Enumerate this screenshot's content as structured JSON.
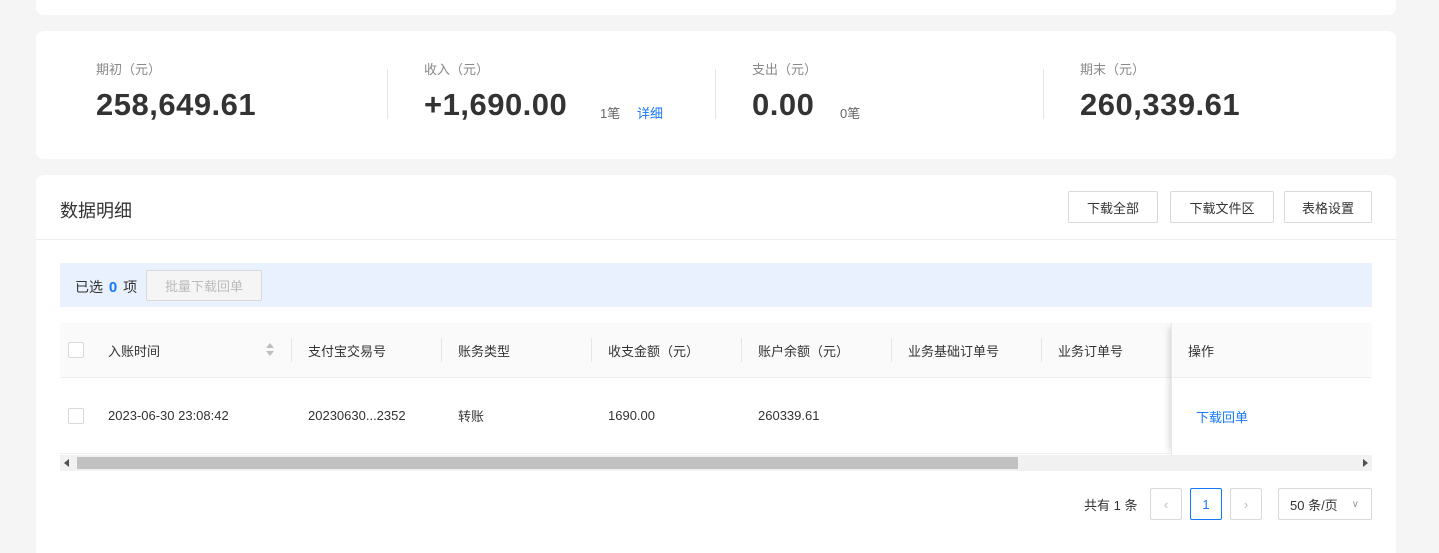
{
  "summary": {
    "opening": {
      "label": "期初（元）",
      "value": "258,649.61"
    },
    "income": {
      "label": "收入（元）",
      "value": "+1,690.00",
      "count": "1笔",
      "link": "详细"
    },
    "expense": {
      "label": "支出（元）",
      "value": "0.00",
      "count": "0笔"
    },
    "closing": {
      "label": "期末（元）",
      "value": "260,339.61"
    }
  },
  "detail": {
    "title": "数据明细",
    "buttons": {
      "download_all": "下载全部",
      "download_area": "下载文件区",
      "table_settings": "表格设置"
    },
    "selection": {
      "prefix": "已选",
      "count": "0",
      "suffix": "项",
      "batch_button": "批量下载回单"
    },
    "columns": [
      "入账时间",
      "支付宝交易号",
      "账务类型",
      "收支金额（元）",
      "账户余额（元）",
      "业务基础订单号",
      "业务订单号",
      "操作"
    ],
    "rows": [
      {
        "time": "2023-06-30 23:08:42",
        "trade_no": "20230630...2352",
        "type": "转账",
        "amount": "1690.00",
        "balance": "260339.61",
        "base_order": "",
        "order": "",
        "action": "下载回单"
      }
    ],
    "pagination": {
      "total": "共有 1 条",
      "current_page": "1",
      "page_size": "50 条/页"
    }
  },
  "colors": {
    "accent": "#1677ff",
    "selection_bg": "#e8f1fd"
  }
}
